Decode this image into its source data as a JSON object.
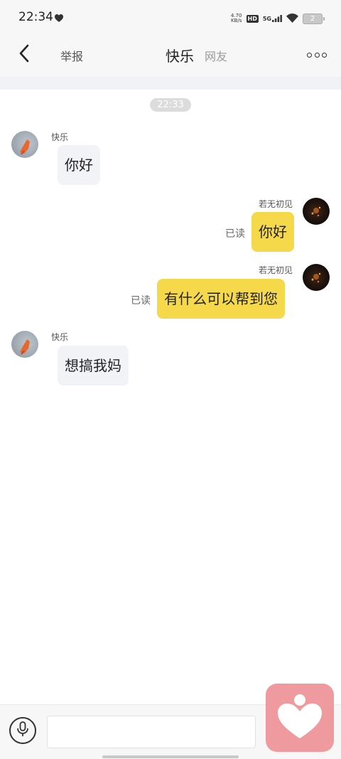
{
  "status_bar": {
    "time": "22:34",
    "net_speed_value": "4.70",
    "net_speed_unit": "KB/s",
    "hd": "HD",
    "network": "5G",
    "battery": "2"
  },
  "nav": {
    "report_label": "举报",
    "title": "快乐",
    "subtitle": "网友"
  },
  "chat": {
    "timestamp": "22:33",
    "messages": [
      {
        "direction": "incoming",
        "sender": "快乐",
        "text": "你好"
      },
      {
        "direction": "outgoing",
        "sender": "若无初见",
        "text": "你好",
        "read": "已读"
      },
      {
        "direction": "outgoing",
        "sender": "若无初见",
        "text": "有什么可以帮到您",
        "read": "已读"
      },
      {
        "direction": "incoming",
        "sender": "快乐",
        "text": "想搞我妈"
      }
    ]
  },
  "input": {
    "value": "",
    "placeholder": ""
  },
  "icons": {
    "back": "chevron-left-icon",
    "more": "more-icon",
    "voice": "microphone-icon",
    "float_app": "heart-app-icon"
  },
  "colors": {
    "outgoing_bubble": "#f6d84b",
    "incoming_bubble": "#f2f3f7",
    "float_app": "#ef9a9e"
  }
}
